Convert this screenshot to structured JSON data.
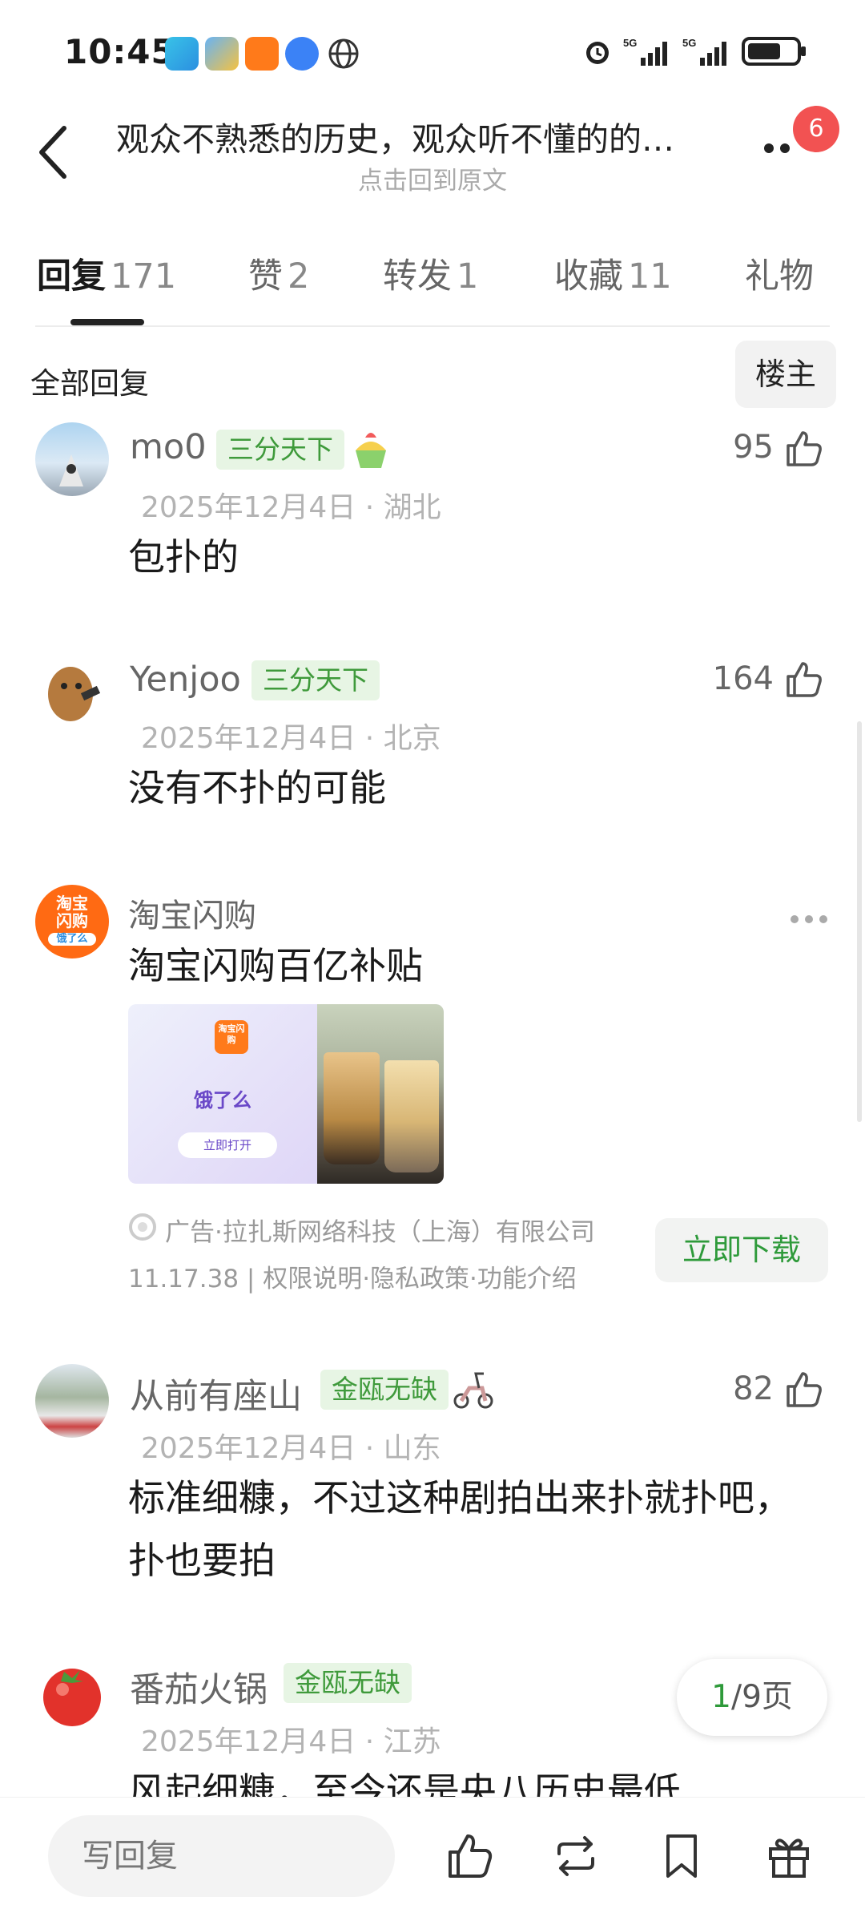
{
  "status_bar": {
    "time": "10:45"
  },
  "header": {
    "title": "观众不熟悉的历史，观众听不懂的的…",
    "subtitle": "点击回到原文",
    "badge_count": "6"
  },
  "tabs": [
    {
      "label": "回复",
      "count": "171"
    },
    {
      "label": "赞",
      "count": "2"
    },
    {
      "label": "转发",
      "count": "1"
    },
    {
      "label": "收藏",
      "count": "11"
    },
    {
      "label": "礼物",
      "count": ""
    }
  ],
  "section": {
    "title": "全部回复",
    "owner_filter": "楼主"
  },
  "comments": [
    {
      "username": "mo0",
      "tag": "三分天下",
      "date": "2025年12月4日 · 湖北",
      "content": "包扑的",
      "likes": "95"
    },
    {
      "username": "Yenjoo",
      "tag": "三分天下",
      "date": "2025年12月4日 · 北京",
      "content": "没有不扑的可能",
      "likes": "164"
    },
    {
      "username": "从前有座山",
      "tag": "金瓯无缺",
      "date": "2025年12月4日 · 山东",
      "content_line1": "标准细糠，不过这种剧拍出来扑就扑吧，",
      "content_line2": "扑也要拍",
      "likes": "82"
    },
    {
      "username": "番茄火锅",
      "tag": "金瓯无缺",
      "date": "2025年12月4日 · 江苏",
      "content": "风起细糠，至今还是央八历史最低"
    }
  ],
  "ad": {
    "name": "淘宝闪购",
    "avatar_text_line1": "淘宝",
    "avatar_text_line2": "闪购",
    "avatar_text_line3": "饿了么",
    "text": "淘宝闪购百亿补贴",
    "image_app_name": "饿了么",
    "image_button": "立即打开",
    "image_icon_text": "淘宝闪购",
    "disclaimer": "广告·拉扎斯网络科技（上海）有限公司",
    "details": "11.17.38 | 权限说明·隐私政策·功能介绍",
    "download_label": "立即下载"
  },
  "pagination": {
    "current": "1",
    "total": "/9页"
  },
  "bottom_bar": {
    "reply_placeholder": "写回复"
  }
}
